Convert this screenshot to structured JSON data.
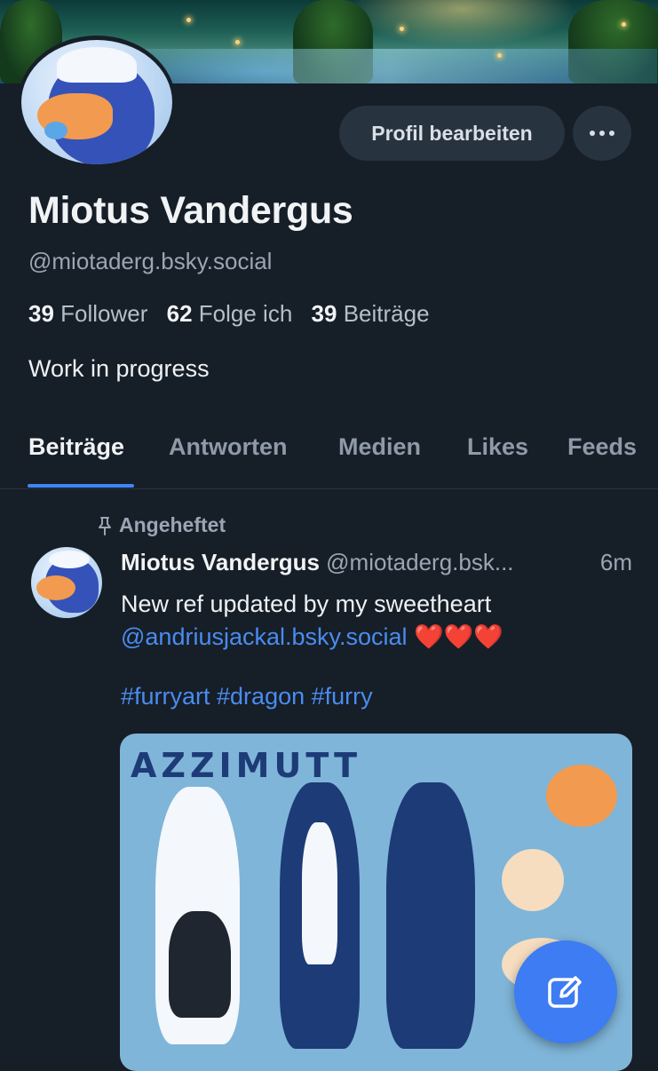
{
  "profile": {
    "display_name": "Miotus Vandergus",
    "handle": "@miotaderg.bsky.social",
    "followers_count": "39",
    "followers_label": "Follower",
    "following_count": "62",
    "following_label": "Folge ich",
    "posts_count": "39",
    "posts_label": "Beiträge",
    "bio": "Work in progress",
    "edit_button": "Profil bearbeiten"
  },
  "tabs": [
    {
      "label": "Beiträge",
      "active": true
    },
    {
      "label": "Antworten",
      "active": false
    },
    {
      "label": "Medien",
      "active": false
    },
    {
      "label": "Likes",
      "active": false
    },
    {
      "label": "Feeds",
      "active": false
    }
  ],
  "post": {
    "pinned_label": "Angeheftet",
    "author": "Miotus Vandergus",
    "handle": "@miotaderg.bsk...",
    "time": "6m",
    "text_line1": "New ref updated by my sweetheart",
    "mention": "@andriusjackal.bsky.social",
    "hearts": "❤️❤️❤️",
    "hashtags": "#furryart #dragon #furry",
    "media_title": "AZZIMUTT"
  },
  "colors": {
    "background": "#161e27",
    "accent": "#3f86f5",
    "link": "#4a8cf0",
    "button_bg": "#283340"
  },
  "icons": {
    "more": "ellipsis-icon",
    "pin": "pin-icon",
    "compose": "compose-icon"
  }
}
